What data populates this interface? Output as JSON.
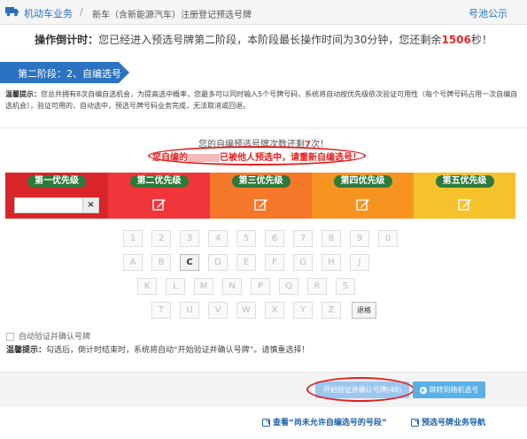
{
  "topbar": {
    "crumb_home": "机动车业务",
    "separator": "/",
    "crumb_current": "新车（含新能源汽车）注册登记预选号牌",
    "notice_link": "号池公示"
  },
  "countdown": {
    "label": "操作倒计时：",
    "text_before": "您已经进入预选号牌第二阶段，本阶段最长操作时间为30分钟，您还剩余",
    "seconds": "1506",
    "text_after": "秒！"
  },
  "stage": {
    "label": "第二阶段：2、自编选号"
  },
  "tip": {
    "label": "温馨提示：",
    "text": "您总共拥有8次自编自选机会，为提高选中概率，您最多可以同时输入5个号牌号码，系统将自动按优先级依次验证可用性（每个号牌号码占用一次自编自选机会），验证可用的，自动选中，预选号牌号码业务完成，无法取消或回退。"
  },
  "remain": {
    "before": "您的自编预选号牌次数还剩",
    "count": "7",
    "after": "次！"
  },
  "warning": {
    "before": "您自编的",
    "after": "已被他人预选中，请重新自编选号！"
  },
  "priorities": [
    {
      "label": "第一优先级"
    },
    {
      "label": "第二优先级"
    },
    {
      "label": "第三优先级"
    },
    {
      "label": "第四优先级"
    },
    {
      "label": "第五优先级"
    }
  ],
  "slot1": {
    "clear": "×"
  },
  "keyboard": {
    "row1": [
      "1",
      "2",
      "3",
      "4",
      "5",
      "6",
      "7",
      "8",
      "9",
      "0"
    ],
    "row2": [
      "A",
      "B",
      "C",
      "D",
      "E",
      "F",
      "G",
      "H",
      "J"
    ],
    "row3": [
      "K",
      "L",
      "M",
      "N",
      "P",
      "Q",
      "R",
      "S"
    ],
    "row4": [
      "T",
      "U",
      "V",
      "W",
      "X",
      "Y",
      "Z"
    ],
    "backspace": "退格",
    "active_key": "C"
  },
  "auto_verify": {
    "label": "自动验证并确认号牌"
  },
  "hint": {
    "label": "温馨提示：",
    "text": "勾选后，倒计时结束时，系统将自动“开始验证并确认号牌”。请慎重选择！"
  },
  "buttons": {
    "verify": "开始验证并确认号牌(48)",
    "random": "跳转到随机选号"
  },
  "links": {
    "disallowed": "查看“尚未允许自编选号的号段”",
    "guide": "预选号牌业务导航"
  },
  "colors": {
    "accent": "#2b73c2",
    "alert": "#e02020",
    "prio1": "#d8252a",
    "prio2": "#f0363a",
    "prio3": "#f5782a",
    "prio4": "#f79421",
    "prio5": "#f6c22b"
  }
}
